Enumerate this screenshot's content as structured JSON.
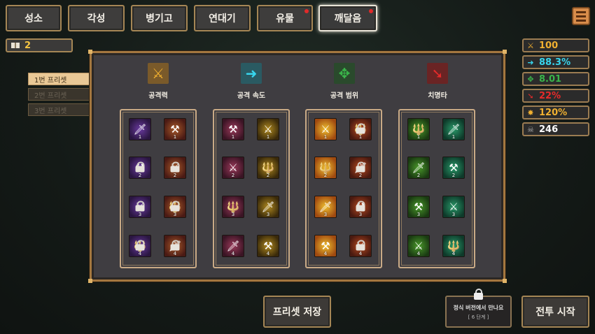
{
  "tabs": [
    {
      "label": "성소",
      "badge": false
    },
    {
      "label": "각성",
      "badge": false
    },
    {
      "label": "병기고",
      "badge": false
    },
    {
      "label": "연대기",
      "badge": false
    },
    {
      "label": "유물",
      "badge": true
    },
    {
      "label": "깨달음",
      "badge": true,
      "active": true
    }
  ],
  "book_count": "2",
  "presets": [
    {
      "label": "1번 프리셋",
      "selected": true
    },
    {
      "label": "2번 프리셋",
      "selected": false
    },
    {
      "label": "3번 프리셋",
      "selected": false
    }
  ],
  "categories": [
    {
      "label": "공격력",
      "icon": "sword-icon",
      "color": "#f0b030",
      "bg": "#7a5a2a"
    },
    {
      "label": "공격 속도",
      "icon": "arrow-right-icon",
      "color": "#38d6ee",
      "bg": "#2a5a62"
    },
    {
      "label": "공격 범위",
      "icon": "cross-arrows-icon",
      "color": "#3ab54a",
      "bg": "#2a4a2c"
    },
    {
      "label": "치명타",
      "icon": "arrow-down-right-icon",
      "color": "#e62a2a",
      "bg": "#6a2424"
    }
  ],
  "item_levels": [
    "1",
    "2",
    "3",
    "4"
  ],
  "stats": [
    {
      "value": "100",
      "icon": "sword-icon",
      "color": "#f0b030"
    },
    {
      "value": "88.3%",
      "icon": "arrow-right-icon",
      "color": "#38d6ee"
    },
    {
      "value": "8.01",
      "icon": "cross-arrows-icon",
      "color": "#3ab54a"
    },
    {
      "value": "22%",
      "icon": "arrow-down-right-icon",
      "color": "#e62a2a"
    },
    {
      "value": "120%",
      "icon": "burst-icon",
      "color": "#f0b030"
    },
    {
      "value": "246",
      "icon": "skull-icon",
      "color": "#ffffff"
    }
  ],
  "buttons": {
    "save_preset": "프리셋 저장",
    "locked_line1": "정식 버전에서 만나요",
    "locked_line2": "[ 6 단계 ]",
    "battle_start": "전투 시작"
  }
}
